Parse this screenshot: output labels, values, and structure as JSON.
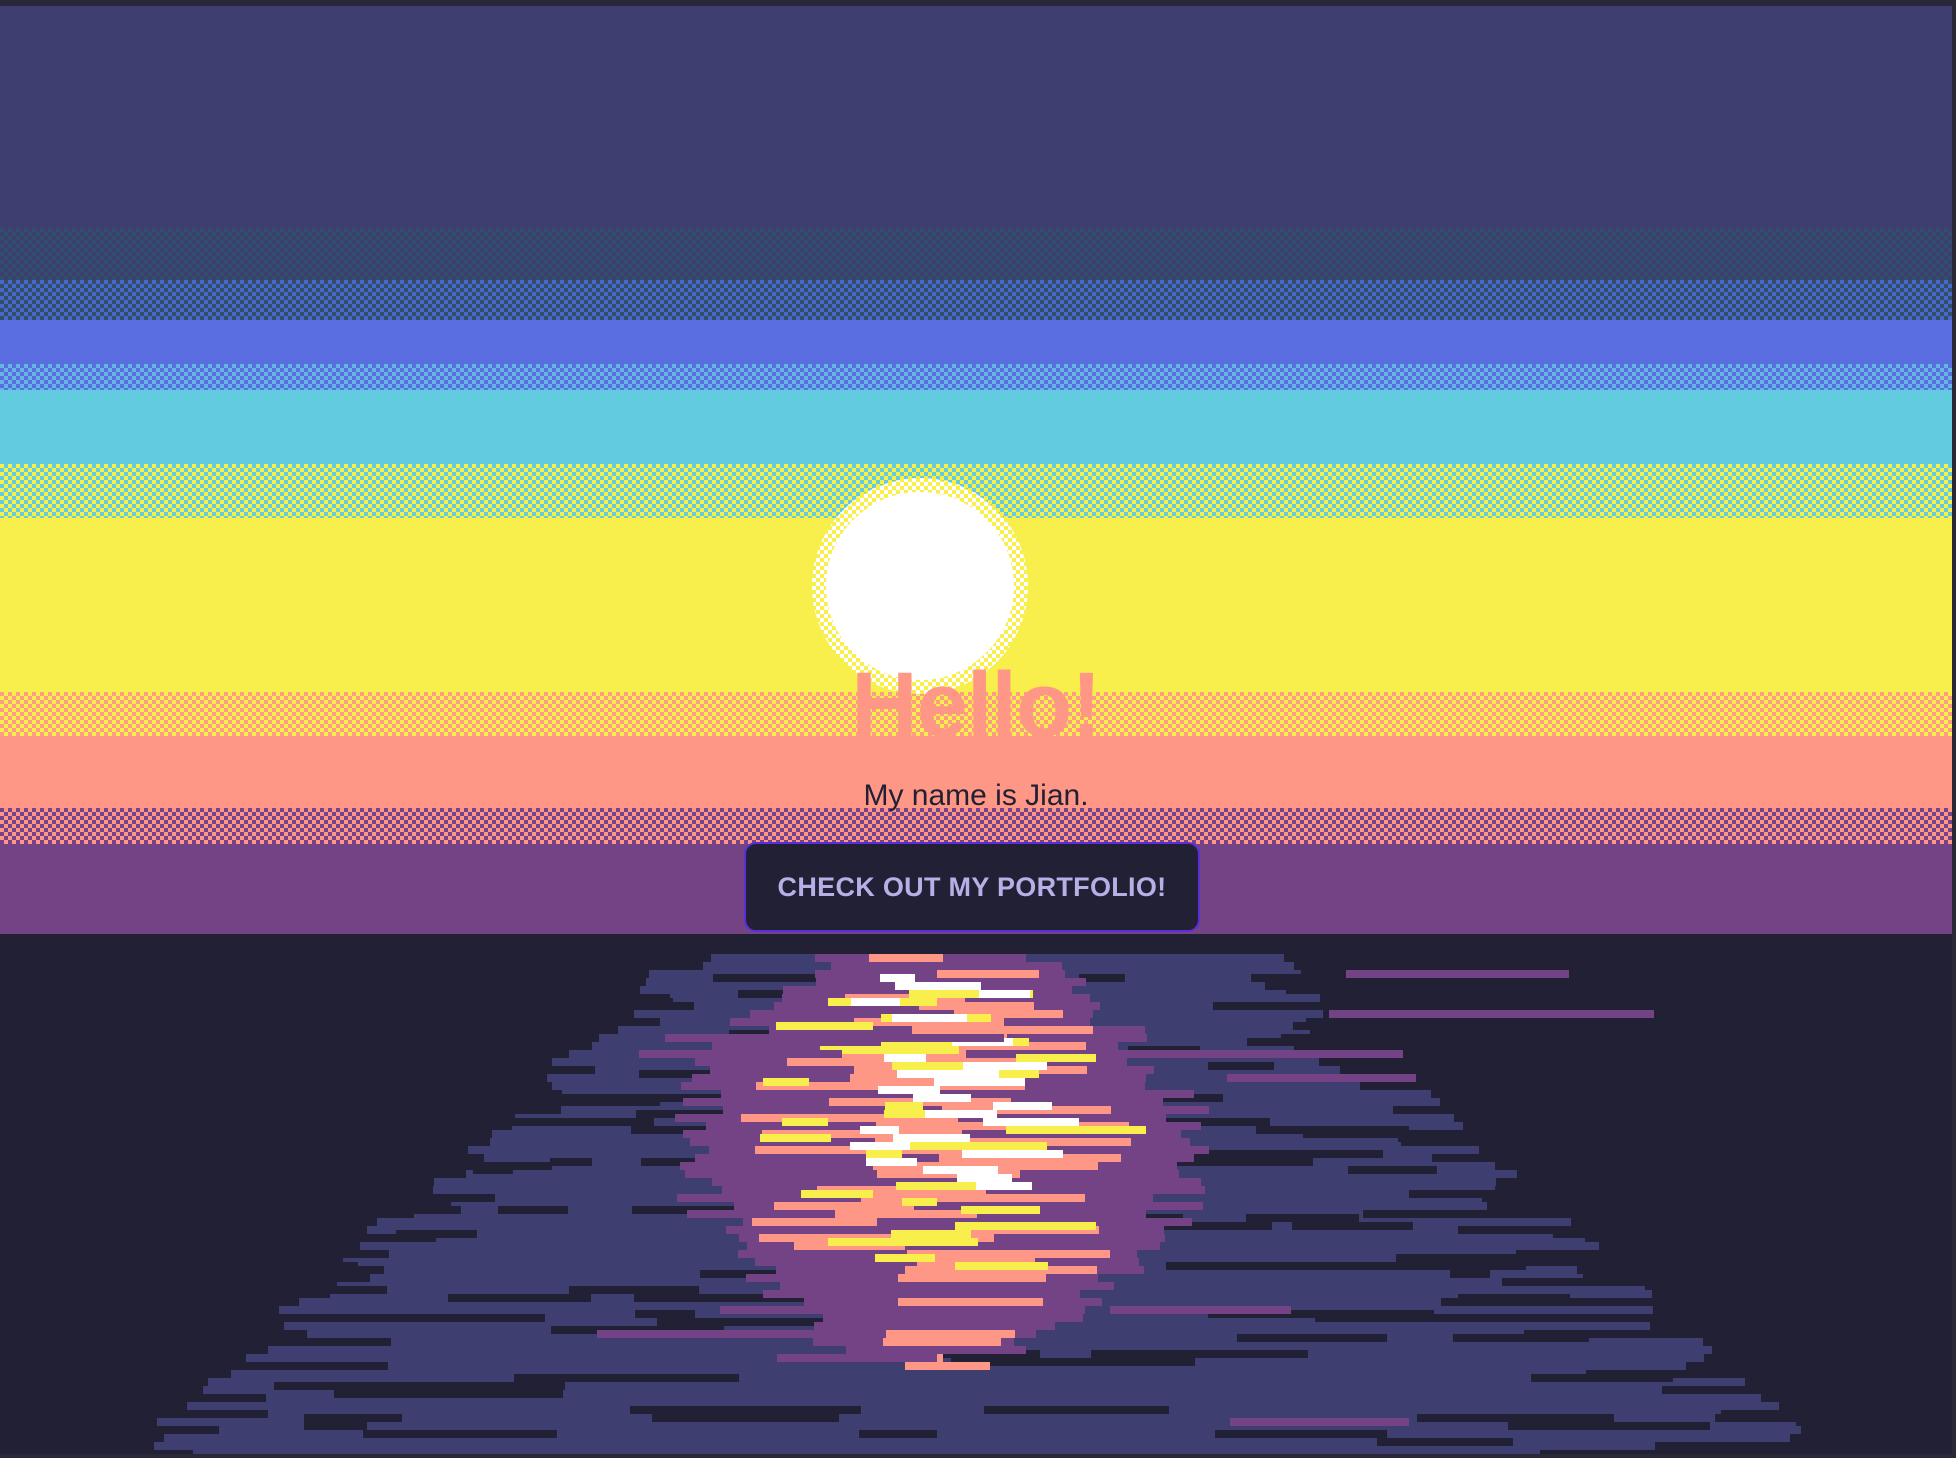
{
  "hero": {
    "title": "Hello!",
    "subtitle": "My name is Jian.",
    "button_label": "CHECK OUT MY PORTFOLIO!"
  },
  "colors": {
    "sky_top": "#3f3e70",
    "blue": "#5b6ee1",
    "cyan": "#63cbe0",
    "yellow": "#f8ef4c",
    "salmon": "#fe9785",
    "purple": "#744386",
    "water_dark": "#222034",
    "water_mid": "#3f3e70",
    "sun": "#ffffff",
    "button_bg": "#222034",
    "button_border": "#5a2ed8",
    "button_text": "#b7b0e6"
  }
}
